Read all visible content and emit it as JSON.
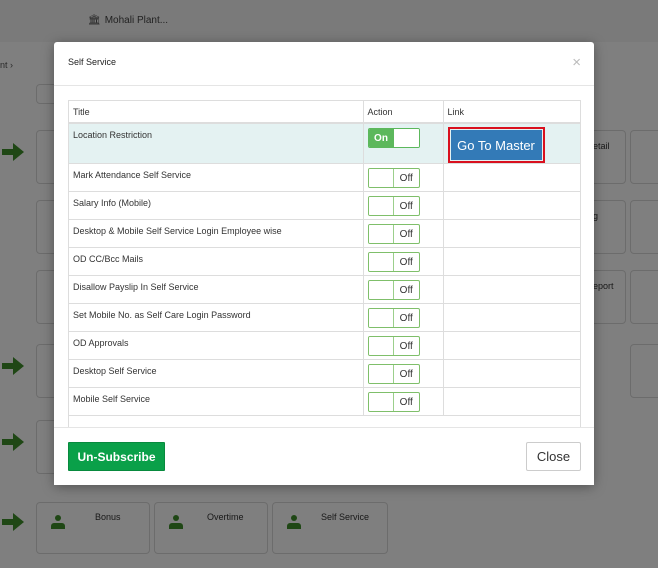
{
  "background": {
    "plant_name": "Mohali Plant...",
    "breadcrumb": "nt  ›",
    "tiles": [
      {
        "label": "Bonus"
      },
      {
        "label": "Overtime"
      },
      {
        "label": "Self Service"
      }
    ],
    "right_tiles": [
      {
        "label": "etail"
      },
      {
        "label": "g"
      },
      {
        "label": "eport"
      }
    ]
  },
  "modal": {
    "title": "Self Service",
    "close_icon": "×",
    "table": {
      "headers": [
        "Title",
        "Action",
        "Link"
      ],
      "rows": [
        {
          "title": "Location Restriction",
          "state": "On",
          "link_label": "Go To Master"
        },
        {
          "title": "Mark Attendance Self Service",
          "state": "Off"
        },
        {
          "title": "Salary Info (Mobile)",
          "state": "Off"
        },
        {
          "title": "Desktop & Mobile Self Service Login Employee wise",
          "state": "Off"
        },
        {
          "title": "OD CC/Bcc Mails",
          "state": "Off"
        },
        {
          "title": "Disallow Payslip In Self Service",
          "state": "Off"
        },
        {
          "title": "Set Mobile No. as Self Care Login Password",
          "state": "Off"
        },
        {
          "title": "OD Approvals",
          "state": "Off"
        },
        {
          "title": "Desktop Self Service",
          "state": "Off"
        },
        {
          "title": "Mobile Self Service",
          "state": "Off"
        }
      ]
    },
    "footer": {
      "unsubscribe_label": "Un-Subscribe",
      "close_label": "Close"
    }
  },
  "colors": {
    "accent_green": "#0aa049",
    "toggle_on": "#5cb85c",
    "link_button": "#337ab7",
    "highlight_border": "#d9101e"
  }
}
